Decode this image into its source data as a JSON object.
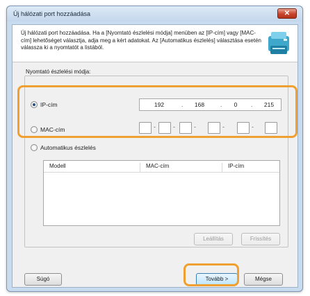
{
  "window": {
    "title": "Új hálózati port hozzáadása",
    "close_glyph": "✕"
  },
  "header": {
    "description": "Új hálózati port hozzáadása. Ha a [Nyomtató észlelési módja] menüben az [IP-cím] vagy [MAC-cím] lehetőséget választja, adja meg a kért adatokat. Az [Automatikus észlelés] választása esetén válassza ki a nyomtatót a listából.",
    "icon": "printer-network-icon"
  },
  "detection": {
    "section_label": "Nyomtató észlelési módja:",
    "ip_option": {
      "label": "IP-cím",
      "selected": true
    },
    "ip_address": [
      "192",
      "168",
      "0",
      "215"
    ],
    "mac_option": {
      "label": "MAC-cím",
      "selected": false
    },
    "auto_option": {
      "label": "Automatikus észlelés",
      "selected": false
    }
  },
  "list": {
    "columns": [
      "Modell",
      "MAC-cím",
      "IP-cím"
    ],
    "rows": []
  },
  "buttons": {
    "stop": "Leállítás",
    "refresh": "Frissítés",
    "help": "Súgó",
    "next": "Tovább >",
    "cancel": "Mégse"
  },
  "colors": {
    "highlight": "#f0a030",
    "window_frame": "#c9dbef",
    "close_button": "#c7442c"
  }
}
